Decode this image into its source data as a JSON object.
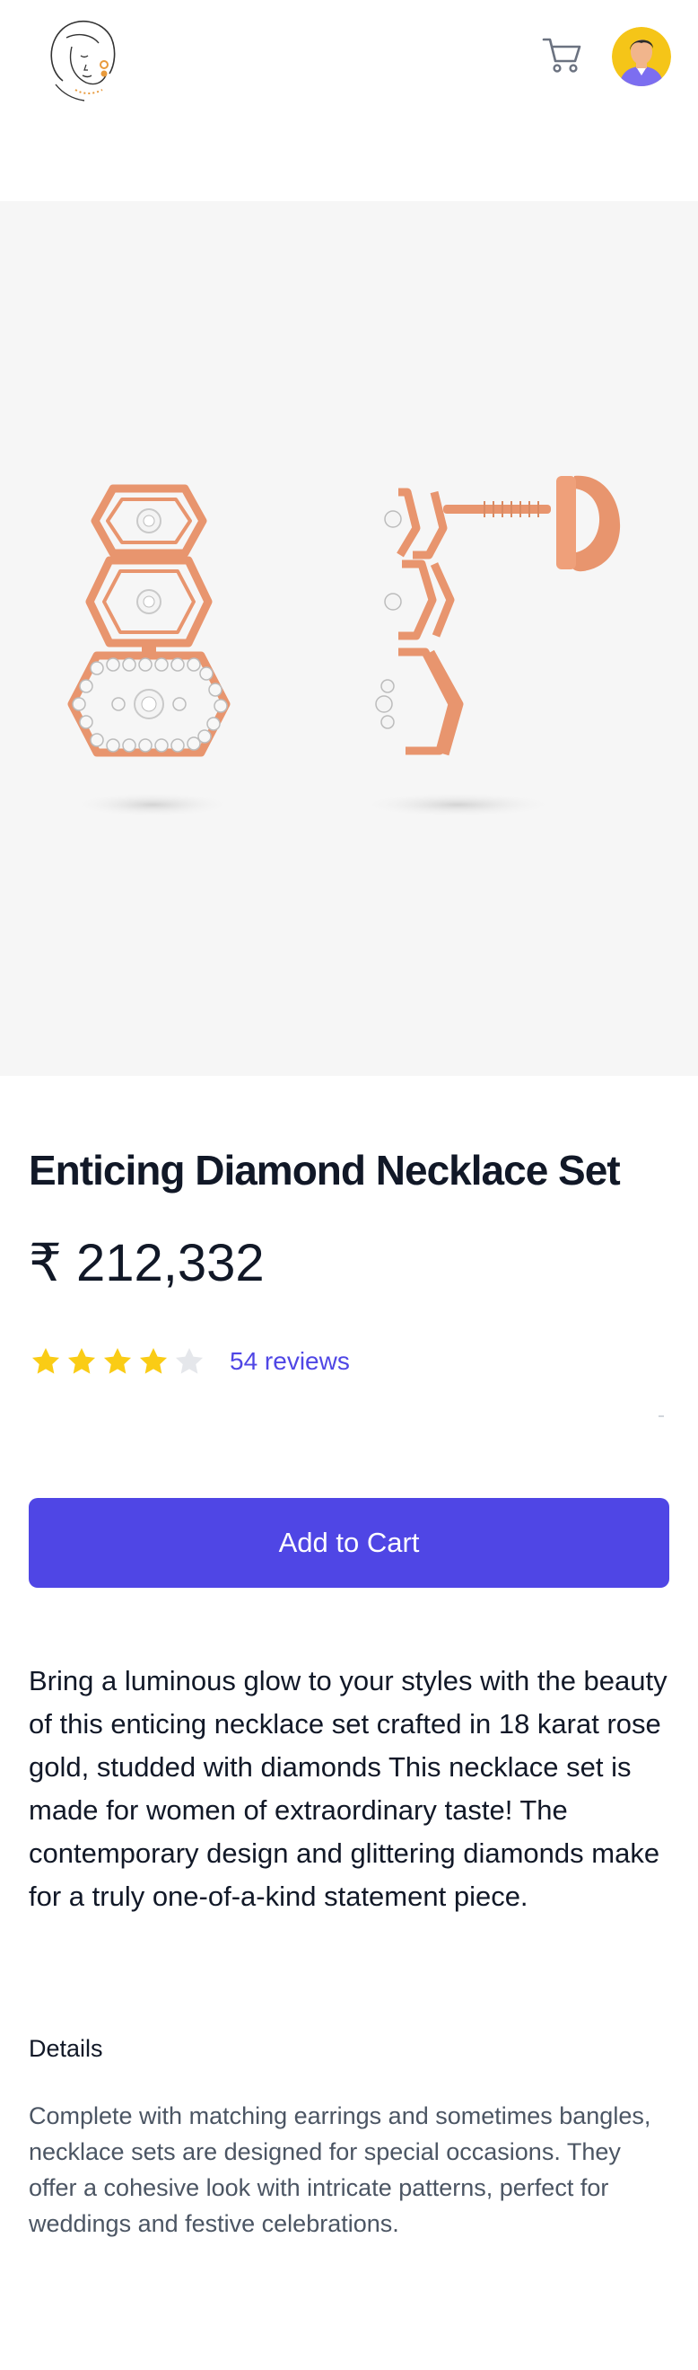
{
  "header": {
    "logo_icon": "woman-face-line-logo",
    "cart_icon": "shopping-cart-icon",
    "avatar_icon": "user-avatar"
  },
  "product": {
    "title": "Enticing Diamond Necklace Set",
    "price": "₹ 212,332",
    "image_alt": "Rose gold hexagon diamond drop earrings",
    "rating": {
      "value": 4,
      "max": 5,
      "reviews_label": "54 reviews"
    },
    "add_to_cart_label": "Add to Cart",
    "description": "Bring a luminous glow to your styles with the beauty of this enticing necklace set crafted in 18 karat rose gold, studded with diamonds This necklace set is made for women of extraordinary taste! The contemporary design and glittering diamonds make for a truly one-of-a-kind statement piece.",
    "details_heading": "Details",
    "details_text": "Complete with matching earrings and sometimes bangles, necklace sets are designed for special occasions. They offer a cohesive look with intricate patterns, perfect for weddings and festive celebrations."
  },
  "colors": {
    "accent": "#4f46e5",
    "star_filled": "#facc15",
    "star_empty": "#e5e7eb",
    "image_bg": "#f6f6f6",
    "rose_gold": "#e8956e"
  }
}
